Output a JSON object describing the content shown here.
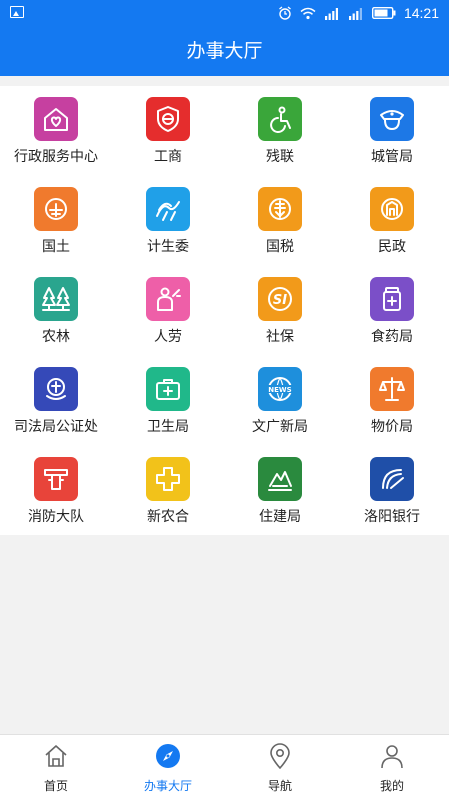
{
  "status_bar": {
    "time": "14:21"
  },
  "header": {
    "title": "办事大厅"
  },
  "grid": [
    {
      "label": "行政服务中心",
      "icon": "heart-house-icon",
      "color": "#c640a0"
    },
    {
      "label": "工商",
      "icon": "emblem-shield-icon",
      "color": "#e52d2d"
    },
    {
      "label": "残联",
      "icon": "disability-icon",
      "color": "#3aa63a"
    },
    {
      "label": "城管局",
      "icon": "officer-cap-icon",
      "color": "#1d78e6"
    },
    {
      "label": "国土",
      "icon": "land-seal-icon",
      "color": "#f07a2d"
    },
    {
      "label": "计生委",
      "icon": "family-planning-icon",
      "color": "#20a0e8"
    },
    {
      "label": "国税",
      "icon": "national-tax-icon",
      "color": "#f29a1a"
    },
    {
      "label": "民政",
      "icon": "civil-affairs-icon",
      "color": "#f29a1a"
    },
    {
      "label": "农林",
      "icon": "trees-icon",
      "color": "#2aa58e"
    },
    {
      "label": "人劳",
      "icon": "worker-icon",
      "color": "#ee5fa8"
    },
    {
      "label": "社保",
      "icon": "social-security-icon",
      "color": "#f29a1a"
    },
    {
      "label": "食药局",
      "icon": "medicine-bottle-icon",
      "color": "#7b4fc8"
    },
    {
      "label": "司法局公证处",
      "icon": "justice-emblem-icon",
      "color": "#3549b8"
    },
    {
      "label": "卫生局",
      "icon": "first-aid-kit-icon",
      "color": "#20b88a"
    },
    {
      "label": "文广新局",
      "icon": "news-globe-icon",
      "color": "#1e8fdc"
    },
    {
      "label": "物价局",
      "icon": "scales-icon",
      "color": "#f07a2d"
    },
    {
      "label": "消防大队",
      "icon": "fire-hydrant-icon",
      "color": "#e8443a"
    },
    {
      "label": "新农合",
      "icon": "medical-cross-icon",
      "color": "#f2c21a"
    },
    {
      "label": "住建局",
      "icon": "building-landscape-icon",
      "color": "#2a8a3e"
    },
    {
      "label": "洛阳银行",
      "icon": "bank-logo-icon",
      "color": "#1f4fa8"
    }
  ],
  "nav": [
    {
      "label": "首页",
      "icon": "home-icon",
      "active": false
    },
    {
      "label": "办事大厅",
      "icon": "compass-icon",
      "active": true,
      "accent": "#1479f1"
    },
    {
      "label": "导航",
      "icon": "location-pin-icon",
      "active": false
    },
    {
      "label": "我的",
      "icon": "user-icon",
      "active": false
    }
  ]
}
